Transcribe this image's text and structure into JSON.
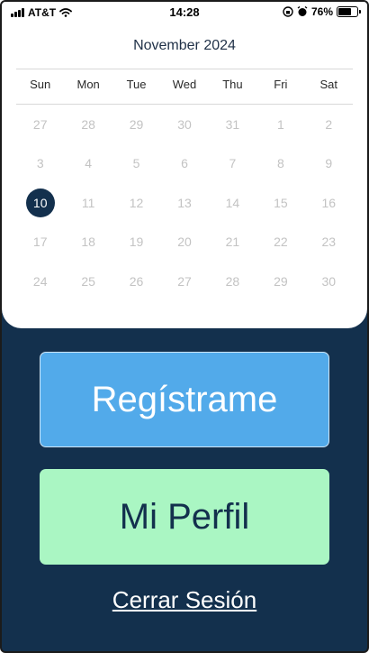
{
  "status_bar": {
    "carrier": "AT&T",
    "time": "14:28",
    "battery_percent": "76%",
    "battery_level": 0.76
  },
  "calendar": {
    "month_title": "November 2024",
    "weekdays": [
      "Sun",
      "Mon",
      "Tue",
      "Wed",
      "Thu",
      "Fri",
      "Sat"
    ],
    "weeks": [
      [
        "27",
        "28",
        "29",
        "30",
        "31",
        "1",
        "2"
      ],
      [
        "3",
        "4",
        "5",
        "6",
        "7",
        "8",
        "9"
      ],
      [
        "10",
        "11",
        "12",
        "13",
        "14",
        "15",
        "16"
      ],
      [
        "17",
        "18",
        "19",
        "20",
        "21",
        "22",
        "23"
      ],
      [
        "24",
        "25",
        "26",
        "27",
        "28",
        "29",
        "30"
      ]
    ],
    "selected_day": "10"
  },
  "buttons": {
    "register": "Regístrame",
    "profile": "Mi Perfil",
    "logout": "Cerrar Sesión"
  },
  "colors": {
    "background": "#13304d",
    "register_button": "#52aaea",
    "profile_button": "#aaf6c3",
    "selected_day": "#13304d"
  }
}
